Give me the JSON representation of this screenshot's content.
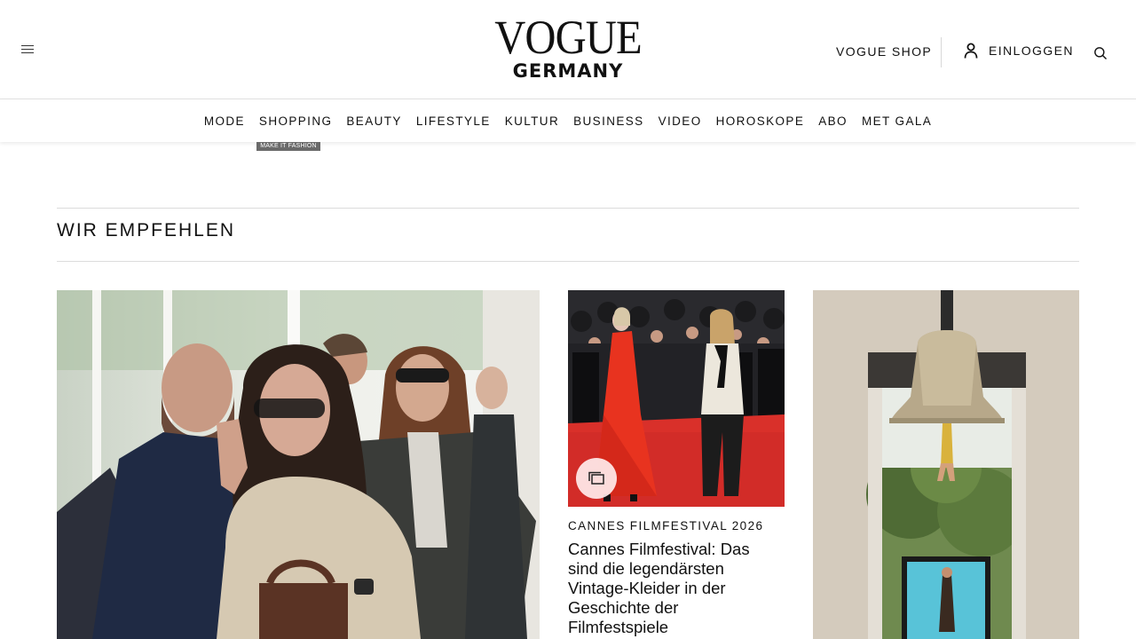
{
  "header": {
    "logo_main": "VOGUE",
    "logo_sub": "GERMANY",
    "shop_label": "VOGUE SHOP",
    "login_label": "EINLOGGEN"
  },
  "nav": {
    "items": [
      "MODE",
      "SHOPPING",
      "BEAUTY",
      "LIFESTYLE",
      "KULTUR",
      "BUSINESS",
      "VIDEO",
      "HOROSKOPE",
      "ABO",
      "MET GALA"
    ]
  },
  "ad_label": "MAKE IT FASHION",
  "section": {
    "title": "WIR EMPFEHLEN"
  },
  "cards": [
    {
      "kicker": "",
      "headline": ""
    },
    {
      "kicker": "CANNES FILMFESTIVAL 2026",
      "headline": "Cannes Filmfestival: Das sind die legendärsten Vintage-Kleider in der Geschichte der Filmfestspiele"
    },
    {
      "kicker": "",
      "headline": ""
    }
  ],
  "colors": {
    "text": "#111111",
    "rule": "#dcdcdc",
    "gallery_button_bg": "#ffebeb",
    "red_carpet": "#d9302a"
  },
  "icons": [
    "hamburger-menu-icon",
    "user-icon",
    "search-icon",
    "gallery-icon"
  ]
}
